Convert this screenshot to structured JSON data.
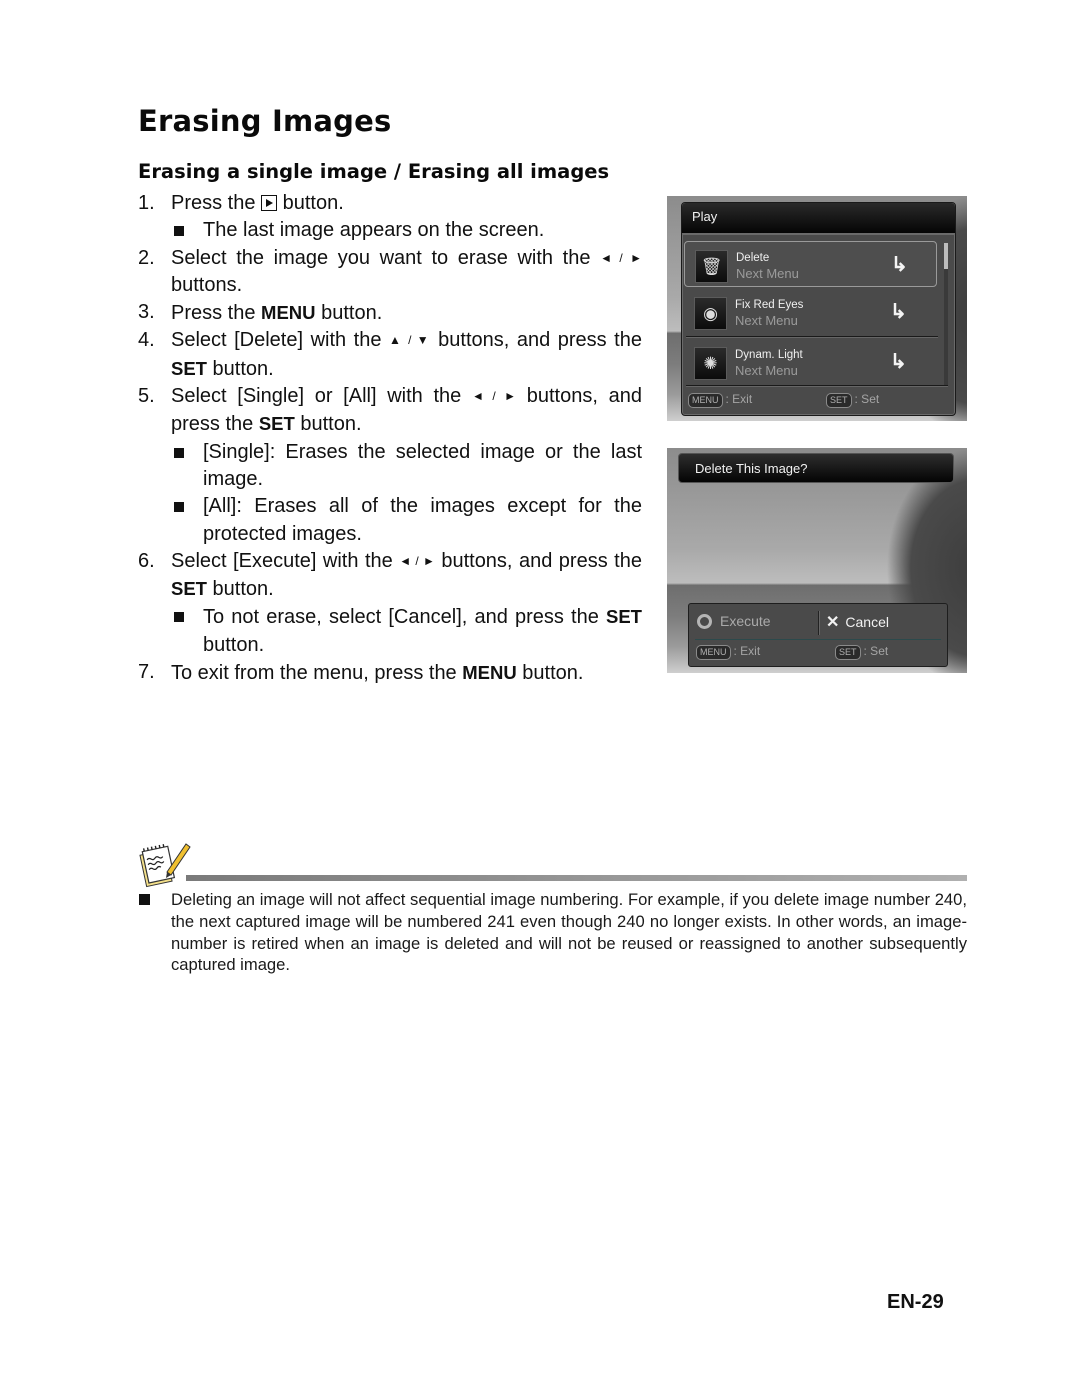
{
  "title": "Erasing Images",
  "subtitle": "Erasing a single image / Erasing all images",
  "steps": [
    {
      "num": "1.",
      "pre": "Press the",
      "icon": "play-button-icon",
      "post": "button."
    },
    {
      "bullet": "The last image appears on the screen."
    },
    {
      "num": "2.",
      "text": "Select the image you want to erase with the",
      "arrows": "◄ / ►",
      "post": "buttons."
    },
    {
      "num": "3.",
      "pre": "Press the",
      "key": "MENU",
      "post": "button."
    },
    {
      "num": "4.",
      "pre": "Select [Delete] with the",
      "arrows": "▲ / ▼",
      "mid": "buttons, and press the",
      "key": "SET",
      "post": "button."
    },
    {
      "num": "5.",
      "pre": "Select [Single] or [All] with the",
      "arrows": "◄ / ►",
      "mid": "buttons, and press the",
      "key": "SET",
      "post": "button."
    },
    {
      "bullet": "[Single]: Erases the selected image or the last image."
    },
    {
      "bullet": "[All]: Erases all of the images except for the protected images."
    },
    {
      "num": "6.",
      "pre": "Select [Execute] with the",
      "arrows": "◄ / ►",
      "mid": "buttons, and press the",
      "key": "SET",
      "post": "button."
    },
    {
      "bullet_pre": "To not erase, select [Cancel], and press the",
      "key": "SET",
      "post": "button."
    },
    {
      "num": "7.",
      "pre": "To exit from the menu, press the",
      "key": "MENU",
      "post": "button."
    }
  ],
  "screen1": {
    "title": "Play",
    "items": [
      {
        "label": "Delete",
        "sub": "Next Menu",
        "icon": "trash-icon",
        "selected": true
      },
      {
        "label": "Fix Red Eyes",
        "sub": "Next Menu",
        "icon": "red-eye-icon",
        "selected": false
      },
      {
        "label": "Dynam. Light",
        "sub": "Next Menu",
        "icon": "dynamic-light-icon",
        "selected": false
      }
    ],
    "arrow": "↳",
    "footer": {
      "menu_key": "MENU",
      "menu_action": ": Exit",
      "set_key": "SET",
      "set_action": ": Set"
    }
  },
  "screen2": {
    "title": "Delete This Image?",
    "options": {
      "execute": "Execute",
      "cancel": "Cancel"
    },
    "footer": {
      "menu_key": "MENU",
      "menu_action": ": Exit",
      "set_key": "SET",
      "set_action": ": Set"
    }
  },
  "note": {
    "text": "Deleting an image will not affect sequential image numbering. For example, if you delete image number 240, the next captured image will be numbered 241 even though 240 no longer exists. In other words, an image-number is retired when an image is deleted and will not be reused or reassigned to another subsequently captured image."
  },
  "page_number": "EN-29"
}
